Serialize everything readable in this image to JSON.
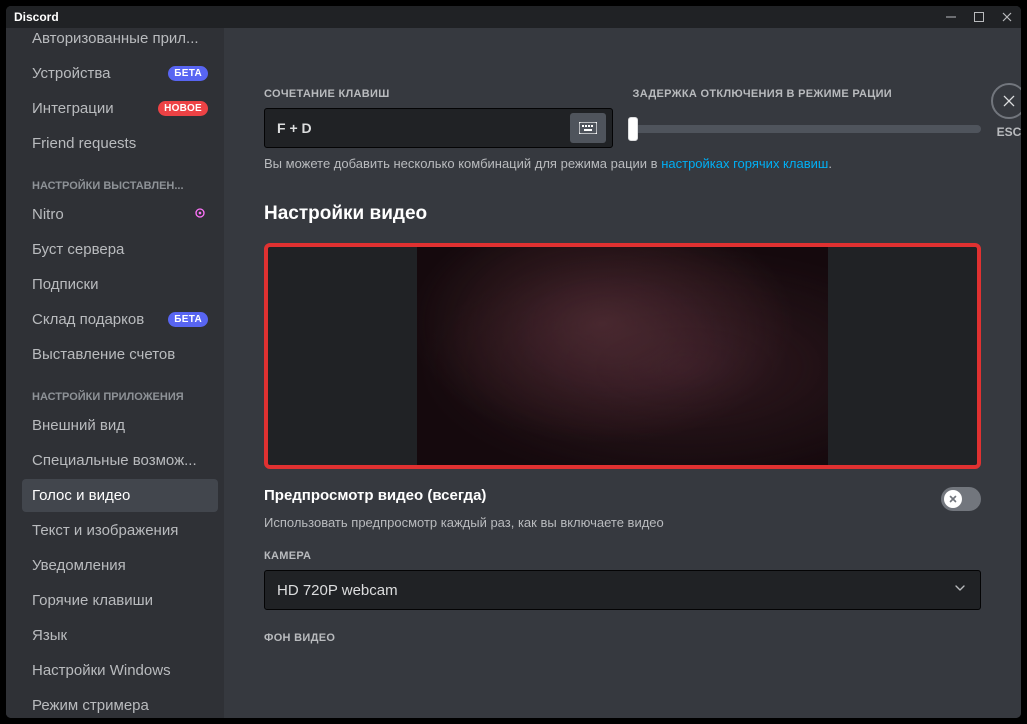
{
  "window": {
    "title": "Discord",
    "esc_label": "ESC"
  },
  "sidebar": {
    "items_top": [
      {
        "label": "Авторизованные прил..."
      },
      {
        "label": "Устройства",
        "badge": "БЕТА",
        "badge_kind": "beta"
      },
      {
        "label": "Интеграции",
        "badge": "НОВОЕ",
        "badge_kind": "new"
      },
      {
        "label": "Friend requests"
      }
    ],
    "header_billing": "НАСТРОЙКИ ВЫСТАВЛЕН...",
    "items_billing": [
      {
        "label": "Nitro",
        "nitro": true
      },
      {
        "label": "Буст сервера"
      },
      {
        "label": "Подписки"
      },
      {
        "label": "Склад подарков",
        "badge": "БЕТА",
        "badge_kind": "beta"
      },
      {
        "label": "Выставление счетов"
      }
    ],
    "header_app": "НАСТРОЙКИ ПРИЛОЖЕНИЯ",
    "items_app": [
      {
        "label": "Внешний вид"
      },
      {
        "label": "Специальные возмож..."
      },
      {
        "label": "Голос и видео",
        "selected": true
      },
      {
        "label": "Текст и изображения"
      },
      {
        "label": "Уведомления"
      },
      {
        "label": "Горячие клавиши"
      },
      {
        "label": "Язык"
      },
      {
        "label": "Настройки Windows"
      },
      {
        "label": "Режим стримера"
      }
    ]
  },
  "main": {
    "shortcut_label": "СОЧЕТАНИЕ КЛАВИШ",
    "shortcut_value": "F + D",
    "delay_label": "ЗАДЕРЖКА ОТКЛЮЧЕНИЯ В РЕЖИМЕ РАЦИИ",
    "hint_prefix": "Вы можете добавить несколько комбинаций для режима рации в ",
    "hint_link": "настройках горячих клавиш",
    "hint_suffix": ".",
    "video_section_title": "Настройки видео",
    "preview_toggle_title": "Предпросмотр видео (всегда)",
    "preview_toggle_desc": "Использовать предпросмотр каждый раз, как вы включаете видео",
    "camera_label": "КАМЕРА",
    "camera_value": "HD 720P webcam",
    "background_label": "ФОН ВИДЕО"
  }
}
